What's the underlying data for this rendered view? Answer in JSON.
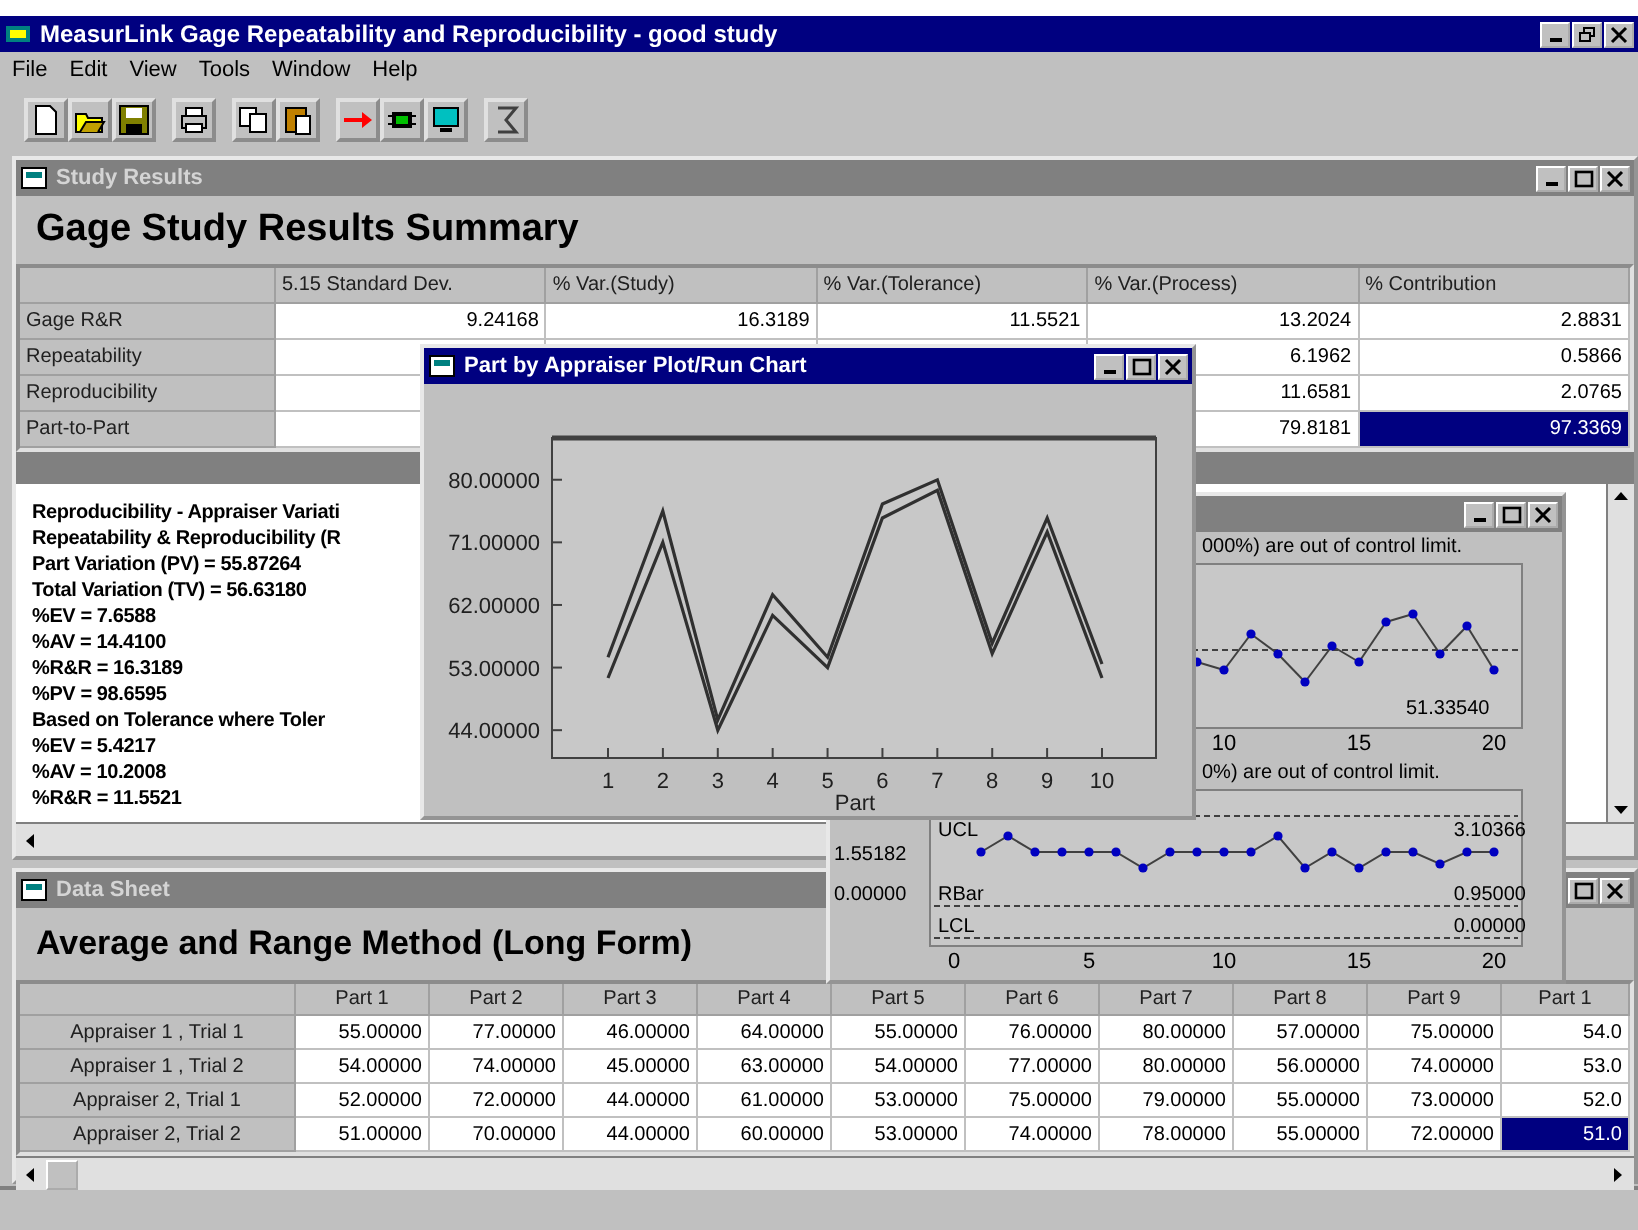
{
  "app": {
    "title": "MeasurLink Gage Repeatability and Reproducibility - good study"
  },
  "menu": [
    "File",
    "Edit",
    "View",
    "Tools",
    "Window",
    "Help"
  ],
  "study_results": {
    "title": "Study Results",
    "heading": "Gage Study Results Summary",
    "columns": [
      "5.15 Standard Dev.",
      "% Var.(Study)",
      "% Var.(Tolerance)",
      "% Var.(Process)",
      "% Contribution"
    ],
    "rows": [
      {
        "label": "Gage R&R",
        "cells": [
          {
            "text": "9.24168",
            "selected": false
          },
          {
            "text": "16.3189",
            "selected": false
          },
          {
            "text": "11.5521",
            "selected": false
          },
          {
            "text": "13.2024",
            "selected": false
          },
          {
            "text": "2.8831",
            "selected": false
          }
        ]
      },
      {
        "label": "Repeatability",
        "cells": [
          {},
          {},
          {},
          {
            "text": "6.1962",
            "selected": false
          },
          {
            "text": "0.5866",
            "selected": false
          }
        ]
      },
      {
        "label": "Reproducibility",
        "cells": [
          {},
          {},
          {},
          {
            "text": "11.6581",
            "selected": false
          },
          {
            "text": "2.0765",
            "selected": false
          }
        ]
      },
      {
        "label": "Part-to-Part",
        "cells": [
          {},
          {},
          {},
          {
            "text": "79.8181",
            "selected": false
          },
          {
            "text": "97.3369",
            "selected": true
          }
        ]
      }
    ],
    "report_lines": [
      "Reproducibility - Appraiser Variati",
      "Repeatability & Reproducibility (R",
      "Part Variation (PV) = 55.87264",
      "Total Variation (TV) = 56.63180",
      "%EV = 7.6588",
      "%AV = 14.4100",
      "%R&R = 16.3189",
      "%PV = 98.6595",
      "Based on Tolerance where Toler",
      "%EV = 5.4217",
      "%AV = 10.2008",
      "%R&R = 11.5521"
    ]
  },
  "run_chart": {
    "title": "Part by Appraiser Plot/Run Chart",
    "chart_data": {
      "type": "line",
      "xlabel": "Part",
      "categories": [
        "1",
        "2",
        "3",
        "4",
        "5",
        "6",
        "7",
        "8",
        "9",
        "10"
      ],
      "ylim": [
        40,
        86
      ],
      "yticks": [
        {
          "value": 44,
          "label": "44.00000"
        },
        {
          "value": 53,
          "label": "53.00000"
        },
        {
          "value": 62,
          "label": "62.00000"
        },
        {
          "value": 71,
          "label": "71.00000"
        },
        {
          "value": 80,
          "label": "80.00000"
        }
      ],
      "series": [
        {
          "color": "#303030",
          "values": [
            54.5,
            75.5,
            45.5,
            63.5,
            54.5,
            76.5,
            80,
            56.5,
            74.5,
            53.5
          ]
        },
        {
          "color": "#303030",
          "values": [
            51.5,
            71,
            44,
            60.5,
            53,
            74.5,
            78.5,
            55,
            72.5,
            51.5
          ]
        }
      ]
    }
  },
  "control_chart": {
    "messages": [
      "000%) are out of control limit.",
      "0%) are out of control limit."
    ],
    "upper_value": "51.33540",
    "upper_x_ticks": [
      "10",
      "15",
      "20"
    ],
    "lower_y_ticks": [
      "1.55182",
      "0.00000"
    ],
    "limits": [
      {
        "name": "UCL",
        "value": "3.10366"
      },
      {
        "name": "RBar",
        "value": "0.95000"
      },
      {
        "name": "LCL",
        "value": "0.00000"
      }
    ],
    "lower_x_ticks": [
      "0",
      "5",
      "10",
      "15",
      "20"
    ]
  },
  "data_sheet": {
    "title": "Data Sheet",
    "heading": "Average and Range Method (Long Form)",
    "columns": [
      "Part 1",
      "Part 2",
      "Part 3",
      "Part 4",
      "Part 5",
      "Part 6",
      "Part 7",
      "Part 8",
      "Part 9",
      "Part 1"
    ],
    "rows": [
      {
        "label": "Appraiser 1 , Trial 1",
        "cells": [
          {
            "text": "55.00000",
            "selected": false
          },
          {
            "text": "77.00000",
            "selected": false
          },
          {
            "text": "46.00000",
            "selected": false
          },
          {
            "text": "64.00000",
            "selected": false
          },
          {
            "text": "55.00000",
            "selected": false
          },
          {
            "text": "76.00000",
            "selected": false
          },
          {
            "text": "80.00000",
            "selected": false
          },
          {
            "text": "57.00000",
            "selected": false
          },
          {
            "text": "75.00000",
            "selected": false
          },
          {
            "text": "54.0",
            "selected": false
          }
        ]
      },
      {
        "label": "Appraiser 1 , Trial 2",
        "cells": [
          {
            "text": "54.00000",
            "selected": false
          },
          {
            "text": "74.00000",
            "selected": false
          },
          {
            "text": "45.00000",
            "selected": false
          },
          {
            "text": "63.00000",
            "selected": false
          },
          {
            "text": "54.00000",
            "selected": false
          },
          {
            "text": "77.00000",
            "selected": false
          },
          {
            "text": "80.00000",
            "selected": false
          },
          {
            "text": "56.00000",
            "selected": false
          },
          {
            "text": "74.00000",
            "selected": false
          },
          {
            "text": "53.0",
            "selected": false
          }
        ]
      },
      {
        "label": "Appraiser 2, Trial 1",
        "cells": [
          {
            "text": "52.00000",
            "selected": false
          },
          {
            "text": "72.00000",
            "selected": false
          },
          {
            "text": "44.00000",
            "selected": false
          },
          {
            "text": "61.00000",
            "selected": false
          },
          {
            "text": "53.00000",
            "selected": false
          },
          {
            "text": "75.00000",
            "selected": false
          },
          {
            "text": "79.00000",
            "selected": false
          },
          {
            "text": "55.00000",
            "selected": false
          },
          {
            "text": "73.00000",
            "selected": false
          },
          {
            "text": "52.0",
            "selected": false
          }
        ]
      },
      {
        "label": "Appraiser 2, Trial 2",
        "cells": [
          {
            "text": "51.00000",
            "selected": false
          },
          {
            "text": "70.00000",
            "selected": false
          },
          {
            "text": "44.00000",
            "selected": false
          },
          {
            "text": "60.00000",
            "selected": false
          },
          {
            "text": "53.00000",
            "selected": false
          },
          {
            "text": "74.00000",
            "selected": false
          },
          {
            "text": "78.00000",
            "selected": false
          },
          {
            "text": "55.00000",
            "selected": false
          },
          {
            "text": "72.00000",
            "selected": false
          },
          {
            "text": "51.0",
            "selected": true
          }
        ]
      }
    ]
  }
}
